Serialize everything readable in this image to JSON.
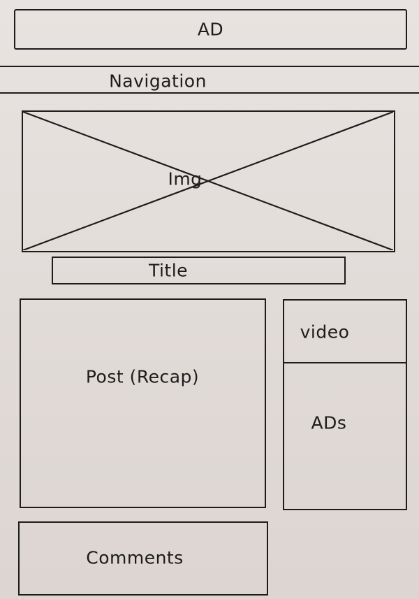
{
  "ad_banner": {
    "label": "AD"
  },
  "navigation": {
    "label": "Navigation"
  },
  "hero": {
    "label": "Img"
  },
  "title_bar": {
    "label": "Title"
  },
  "post": {
    "label": "Post (Recap)"
  },
  "sidebar": {
    "video_label": "video",
    "ads_label": "ADs"
  },
  "comments": {
    "label": "Comments"
  },
  "colors": {
    "ink": "#1e1b1b",
    "paper": "#e4dedb"
  }
}
